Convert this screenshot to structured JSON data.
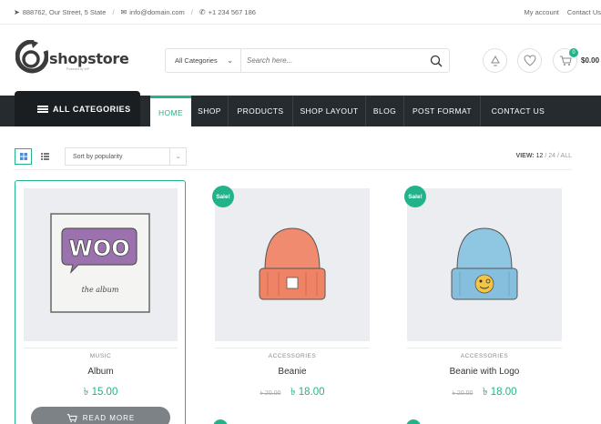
{
  "topbar": {
    "address": "888762, Our Street, 5 State",
    "email": "info@domain.com",
    "phone": "+1 234 567 186",
    "my_account": "My account",
    "contact": "Contact Us",
    "icons": [
      "location-icon",
      "mail-icon",
      "phone-icon"
    ]
  },
  "logo": {
    "text": "shopstore",
    "tagline": "Powered by WP"
  },
  "search": {
    "category": "All Categories",
    "placeholder": "Search here..."
  },
  "header": {
    "cart_count": "0",
    "cart_total": "$0.00",
    "icons": [
      "recycle-icon",
      "heart-icon",
      "cart-icon"
    ]
  },
  "nav": {
    "all_categories": "ALL CATEGORIES",
    "items": [
      "HOME",
      "SHOP",
      "PRODUCTS",
      "SHOP LAYOUT",
      "BLOG",
      "POST FORMAT",
      "CONTACT US"
    ],
    "active": "HOME"
  },
  "toolbar": {
    "sort_label": "Sort by popularity",
    "view_label": "VIEW:",
    "view_options": [
      "12",
      "24",
      "ALL"
    ],
    "view_selected": "12",
    "slash": "/"
  },
  "products": [
    {
      "category": "MUSIC",
      "name": "Album",
      "price": "৳ 15.00",
      "old_price": "",
      "sale": "",
      "button": "READ MORE"
    },
    {
      "category": "ACCESSORIES",
      "name": "Beanie",
      "price": "৳ 18.00",
      "old_price": "৳ 20.00",
      "sale": "Sale!"
    },
    {
      "category": "ACCESSORIES",
      "name": "Beanie with Logo",
      "price": "৳ 18.00",
      "old_price": "৳ 20.00",
      "sale": "Sale!"
    }
  ],
  "album_art": {
    "badge": "WOO",
    "caption": "the album"
  },
  "colors": {
    "accent": "#23b38a",
    "nav_bg": "#252b2f",
    "allcat_bg": "#1a1e21",
    "image_bg": "#ecedf0",
    "beanie": "#f08b6f",
    "beanie_logo": "#8fc6e2"
  }
}
